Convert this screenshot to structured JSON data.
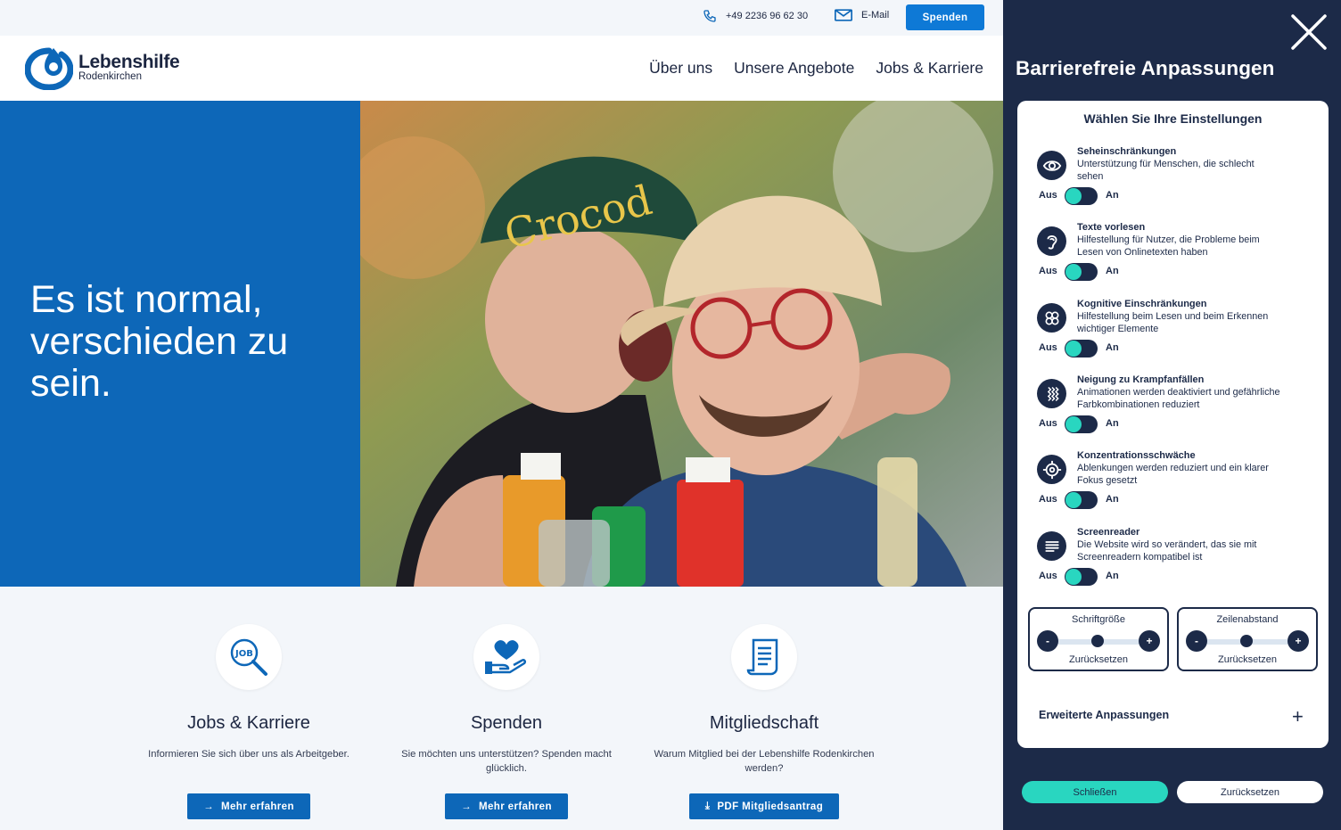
{
  "topbar": {
    "phone": "+49 2236 96 62 30",
    "email_label": "E-Mail",
    "donate_button": "Spenden"
  },
  "header": {
    "logo_name": "Lebenshilfe",
    "logo_sub": "Rodenkirchen",
    "nav": [
      "Über uns",
      "Unsere Angebote",
      "Jobs & Karriere"
    ]
  },
  "hero": {
    "title": "Es ist normal, verschieden zu sein."
  },
  "cards": [
    {
      "icon": "job-search-icon",
      "title": "Jobs & Karriere",
      "text": "Informieren Sie sich über uns als Arbeitgeber.",
      "button": "Mehr erfahren",
      "button_icon": "arrow-right-icon"
    },
    {
      "icon": "heart-hand-icon",
      "title": "Spenden",
      "text": "Sie möchten uns unterstützen? Spenden macht glücklich.",
      "button": "Mehr erfahren",
      "button_icon": "arrow-right-icon"
    },
    {
      "icon": "document-scroll-icon",
      "title": "Mitgliedschaft",
      "text": "Warum Mitglied bei der Lebenshilfe Rodenkirchen werden?",
      "button": "PDF Mitgliedsantrag",
      "button_icon": "download-icon"
    }
  ],
  "panel": {
    "title": "Barrierefreie Anpassungen",
    "box_title": "Wählen Sie Ihre Einstellungen",
    "options": [
      {
        "icon": "eye-icon",
        "title": "Seheinschränkungen",
        "desc": "Unterstützung für Menschen, die schlecht sehen",
        "off": "Aus",
        "on": "An"
      },
      {
        "icon": "ear-icon",
        "title": "Texte vorlesen",
        "desc": "Hilfestellung für Nutzer, die Probleme beim Lesen von Onlinetexten haben",
        "off": "Aus",
        "on": "An"
      },
      {
        "icon": "brain-icon",
        "title": "Kognitive Einschränkungen",
        "desc": "Hilfestellung beim Lesen und beim Erkennen wichtiger Elemente",
        "off": "Aus",
        "on": "An"
      },
      {
        "icon": "waves-icon",
        "title": "Neigung zu Krampfanfällen",
        "desc": "Animationen werden deaktiviert und gefährliche Farbkombinationen reduziert",
        "off": "Aus",
        "on": "An"
      },
      {
        "icon": "target-icon",
        "title": "Konzentrationsschwäche",
        "desc": "Ablenkungen werden reduziert und ein klarer Fokus gesetzt",
        "off": "Aus",
        "on": "An"
      },
      {
        "icon": "lines-icon",
        "title": "Screenreader",
        "desc": "Die Website wird so verändert, das sie mit Screenreadern kompatibel ist",
        "off": "Aus",
        "on": "An"
      }
    ],
    "font_size": {
      "label": "Schriftgröße",
      "minus": "-",
      "plus": "+",
      "reset": "Zurücksetzen"
    },
    "line_spacing": {
      "label": "Zeilenabstand",
      "minus": "-",
      "plus": "+",
      "reset": "Zurücksetzen"
    },
    "advanced": "Erweiterte Anpassungen",
    "advanced_toggle": "+",
    "close_button": "Schließen",
    "reset_button": "Zurücksetzen"
  }
}
